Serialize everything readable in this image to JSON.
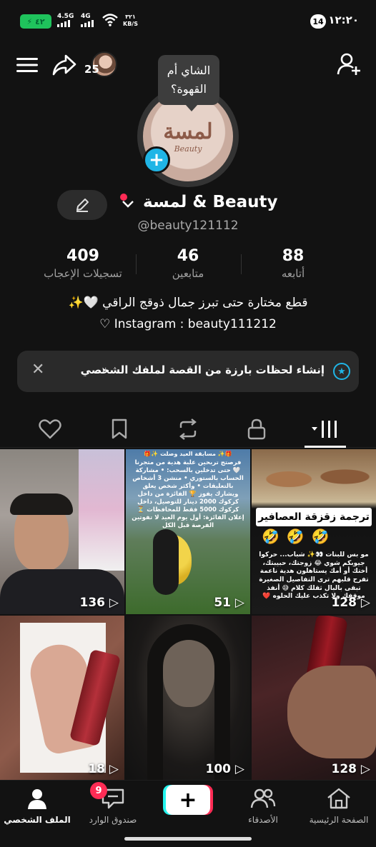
{
  "status_bar": {
    "battery": "٤٢",
    "net1": "4.5G",
    "net2": "4G",
    "speed": "٣٢١",
    "speed_unit": "KB/S",
    "notif_count": "14",
    "time": "١٢:٢٠"
  },
  "header": {
    "story_viewers_count": "25"
  },
  "profile": {
    "bubble_text": "الشاي أم القهوة؟",
    "logo_text": "لمسة",
    "logo_sub": "Beauty",
    "name": "لمسة & Beauty",
    "handle": "@beauty121112",
    "stats": [
      {
        "value": "88",
        "label": "أتابعه"
      },
      {
        "value": "46",
        "label": "متابعين"
      },
      {
        "value": "409",
        "label": "تسجيلات الإعجاب"
      }
    ],
    "bio_line1": "قطع مختارة حتى تبرز جمال ذوقج الراقي 🤍✨",
    "bio_line2": "♡ Instagram : beauty111212"
  },
  "banner": {
    "text": "إنشاء لحظات بارزة من القصة لملفك الشخصي",
    "chevron": "›"
  },
  "tabs": [
    "videos-grid",
    "private-lock",
    "reposts",
    "favorites",
    "liked"
  ],
  "grid": [
    {
      "count": "128",
      "overlay_title": "ترجمة زقزقة العصافير",
      "overlay_body": "مو بس للبنات 👀✨ شباب... حركوا جيوبكم شوي 😂 زوجتك، حبيبتك، أختك أو أمك يستاهلون هدية ناعمة تفرح قلبهم ترى التفاصيل الصغيرة تبقى بالبال ثقلك كلام 😅 أنفذ موقفك ولا تكذب عليك الحلوه ❤️"
    },
    {
      "count": "51",
      "overlay_title": "🎁✨ مسابقة العيد وصلت ✨🎁",
      "overlay_body": "فرصتج تربحين علبة هدية من متجرنا 🤍 حتى تدخلين بالسحب: • مشاركة الحساب بالستوري • منشن 3 أشخاص بالتعليقات • وأكثر شخص يعلق ويشارك يفوز 🏆 الفائزة من داخل كركوك 2000 دينار للتوصيل، داخل كركوك 5000 فقط للمحافظات ⏳ إعلان الفائزة: أول يوم العيد لا تفوتين الفرصة قبل الكل"
    },
    {
      "count": "136"
    },
    {
      "count": "128"
    },
    {
      "count": "100"
    },
    {
      "count": "18"
    }
  ],
  "nav": {
    "home": "الصفحة الرئيسية",
    "friends": "الأصدقاء",
    "inbox": "صندوق الوارد",
    "inbox_badge": "9",
    "profile": "الملف الشخصي"
  },
  "colors": {
    "accent_blue": "#20b5e6",
    "badge_red": "#fe2c55",
    "bg": "#121212"
  }
}
